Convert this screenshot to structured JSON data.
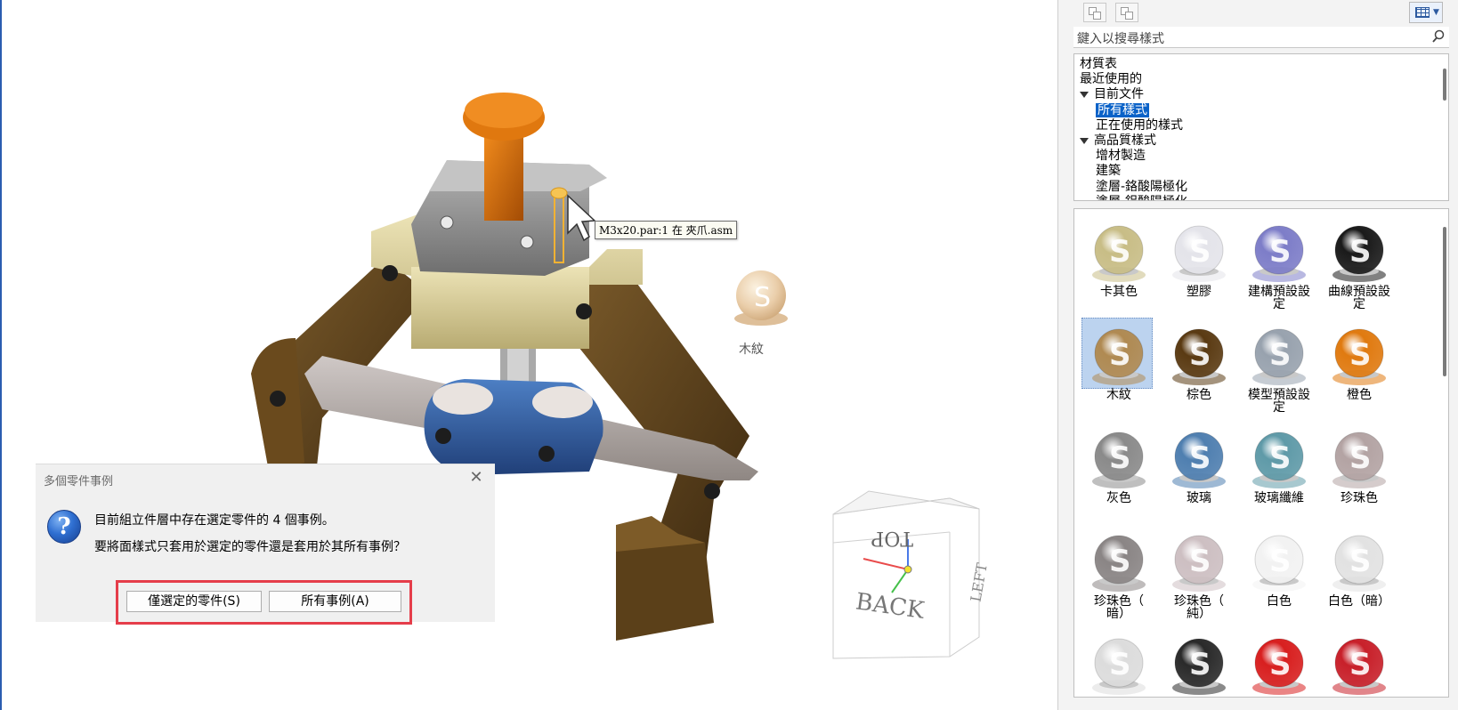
{
  "viewport": {
    "tooltip": "M3x20.par:1 在 夾爪.asm",
    "drag_label": "木紋",
    "viewcube": {
      "top": "TOP",
      "front": "BACK",
      "right": "LEFT"
    }
  },
  "dialog": {
    "title": "多個零件事例",
    "close": "✕",
    "icon": "?",
    "message_line1": "目前組立件層中存在選定零件的 4 個事例。",
    "message_line2": "要將面樣式只套用於選定的零件還是套用於其所有事例？",
    "button_selected": "僅選定的零件(S)",
    "button_all": "所有事例(A)"
  },
  "panel": {
    "search_placeholder": "鍵入以搜尋樣式",
    "tree": [
      {
        "label": "材質表",
        "level": 0
      },
      {
        "label": "最近使用的",
        "level": 0
      },
      {
        "label": "目前文件",
        "level": 0,
        "expanded": true
      },
      {
        "label": "所有樣式",
        "level": 1,
        "selected": true
      },
      {
        "label": "正在使用的樣式",
        "level": 1
      },
      {
        "label": "高品質樣式",
        "level": 0,
        "expanded": true
      },
      {
        "label": "增材製造",
        "level": 1
      },
      {
        "label": "建築",
        "level": 1
      },
      {
        "label": "塗層-鉻酸陽極化",
        "level": 1
      },
      {
        "label": "塗層-鋁酸陽極化",
        "level": 1
      }
    ],
    "materials": [
      {
        "label1": "卡其色",
        "label2": "",
        "color": "#c8bd86"
      },
      {
        "label1": "塑膠",
        "label2": "",
        "color": "#e4e4ea"
      },
      {
        "label1": "建構預設設",
        "label2": "定",
        "color": "#7d7dc8"
      },
      {
        "label1": "曲線預設設",
        "label2": "定",
        "color": "#1a1a1a"
      },
      {
        "label1": "木紋",
        "label2": "",
        "color": "#b08a52",
        "selected": true
      },
      {
        "label1": "棕色",
        "label2": "",
        "color": "#5a3a12"
      },
      {
        "label1": "模型預設設",
        "label2": "定",
        "color": "#98a2ae"
      },
      {
        "label1": "橙色",
        "label2": "",
        "color": "#e07a10"
      },
      {
        "label1": "灰色",
        "label2": "",
        "color": "#8a8a8a"
      },
      {
        "label1": "玻璃",
        "label2": "",
        "color": "#4f7fb0"
      },
      {
        "label1": "玻璃纖維",
        "label2": "",
        "color": "#5f9aa8"
      },
      {
        "label1": "珍珠色",
        "label2": "",
        "color": "#b3a3a3"
      },
      {
        "label1": "珍珠色（",
        "label2": "暗）",
        "color": "#8a8585"
      },
      {
        "label1": "珍珠色（",
        "label2": "純）",
        "color": "#cdbfc2"
      },
      {
        "label1": "白色",
        "label2": "",
        "color": "#f2f2f2"
      },
      {
        "label1": "白色（暗）",
        "label2": "",
        "color": "#e2e2e2"
      },
      {
        "label1": "",
        "label2": "",
        "color": "#dcdcdc"
      },
      {
        "label1": "",
        "label2": "",
        "color": "#2a2a2a"
      },
      {
        "label1": "",
        "label2": "",
        "color": "#d81f1f"
      },
      {
        "label1": "",
        "label2": "",
        "color": "#c8202a"
      }
    ]
  }
}
